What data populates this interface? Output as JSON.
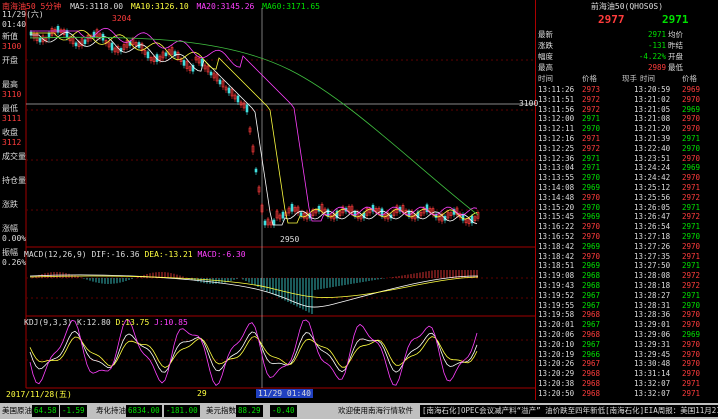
{
  "chart": {
    "title": "南海油50  5分钟",
    "ma": {
      "ma5": "MA5:3118.00",
      "ma10": "MA10:3126.10",
      "ma20": "MA20:3145.26",
      "ma60": "MA60:3171.65"
    },
    "high_mark": "3204",
    "low_mark": "2950",
    "price_level_label": "3100",
    "macd_header": {
      "name": "MACD(12,26,9)",
      "dif": "DIF:-16.36",
      "dea": "DEA:-13.21",
      "macd": "MACD:-6.30"
    },
    "kdj_header": {
      "name": "KDJ(9,3,3)",
      "k": "K:12.80",
      "d": "D:13.75",
      "j": "J:10.85"
    },
    "time_axis": {
      "left": "2017/11/28(五)",
      "mid": "29",
      "cursor": "11/29 01:40"
    },
    "info_box": {
      "date": "11/29(六)",
      "time": "01:40",
      "labels": [
        "新值",
        "开盘",
        "最高",
        "最低",
        "收盘",
        "成交量",
        "持仓量",
        "涨跌",
        "涨幅",
        "振幅"
      ],
      "values": [
        "3100",
        "",
        "3110",
        "3111",
        "3112",
        "",
        "",
        "",
        "0.00%",
        "0.26%"
      ]
    }
  },
  "panel": {
    "title": "前海油50(QHOS0S)",
    "bid_price": "2977",
    "ask_price": "2971",
    "stats": [
      {
        "label": "最新",
        "value": "2971",
        "label2": "均价",
        "color": "grn"
      },
      {
        "label": "涨跌",
        "value": "-131",
        "label2": "昨结",
        "color": "grn"
      },
      {
        "label": "幅度",
        "value": "-4.22%",
        "label2": "开盘",
        "color": "grn"
      },
      {
        "label": "最高",
        "value": "2989",
        "label2": "最低",
        "color": "red"
      }
    ],
    "col_headers": [
      "时间",
      "价格",
      "现手",
      "时间",
      "价格"
    ],
    "ticks_left": [
      {
        "t": "13:11:26",
        "p": "2973",
        "c": "red"
      },
      {
        "t": "13:11:51",
        "p": "2972",
        "c": "red"
      },
      {
        "t": "13:11:56",
        "p": "2972",
        "c": "red"
      },
      {
        "t": "13:12:00",
        "p": "2971",
        "c": "grn"
      },
      {
        "t": "13:12:11",
        "p": "2970",
        "c": "grn"
      },
      {
        "t": "13:12:16",
        "p": "2971",
        "c": "red"
      },
      {
        "t": "13:12:25",
        "p": "2972",
        "c": "red"
      },
      {
        "t": "13:12:36",
        "p": "2971",
        "c": "grn"
      },
      {
        "t": "13:13:04",
        "p": "2971",
        "c": "grn"
      },
      {
        "t": "13:13:55",
        "p": "2970",
        "c": "grn"
      },
      {
        "t": "13:14:08",
        "p": "2969",
        "c": "grn"
      },
      {
        "t": "13:14:48",
        "p": "2970",
        "c": "red"
      },
      {
        "t": "13:15:20",
        "p": "2970",
        "c": "grn"
      },
      {
        "t": "13:15:45",
        "p": "2969",
        "c": "grn"
      },
      {
        "t": "13:16:22",
        "p": "2970",
        "c": "red"
      },
      {
        "t": "13:16:52",
        "p": "2970",
        "c": "red"
      },
      {
        "t": "13:18:42",
        "p": "2969",
        "c": "grn"
      },
      {
        "t": "13:18:42",
        "p": "2970",
        "c": "red"
      },
      {
        "t": "13:18:51",
        "p": "2969",
        "c": "grn"
      },
      {
        "t": "13:19:08",
        "p": "2968",
        "c": "grn"
      },
      {
        "t": "13:19:43",
        "p": "2968",
        "c": "grn"
      },
      {
        "t": "13:19:52",
        "p": "2967",
        "c": "grn"
      },
      {
        "t": "13:19:55",
        "p": "2967",
        "c": "grn"
      },
      {
        "t": "13:19:58",
        "p": "2968",
        "c": "red"
      },
      {
        "t": "13:20:01",
        "p": "2967",
        "c": "grn"
      },
      {
        "t": "13:20:06",
        "p": "2968",
        "c": "red"
      },
      {
        "t": "13:20:10",
        "p": "2967",
        "c": "grn"
      },
      {
        "t": "13:20:19",
        "p": "2966",
        "c": "grn"
      },
      {
        "t": "13:20:26",
        "p": "2967",
        "c": "red"
      },
      {
        "t": "13:20:29",
        "p": "2968",
        "c": "red"
      },
      {
        "t": "13:20:38",
        "p": "2968",
        "c": "red"
      },
      {
        "t": "13:20:50",
        "p": "2968",
        "c": "red"
      }
    ],
    "ticks_right": [
      {
        "t": "13:20:59",
        "p": "2969",
        "c": "red"
      },
      {
        "t": "13:21:02",
        "p": "2970",
        "c": "red"
      },
      {
        "t": "13:21:05",
        "p": "2969",
        "c": "grn"
      },
      {
        "t": "13:21:08",
        "p": "2970",
        "c": "red"
      },
      {
        "t": "13:21:20",
        "p": "2970",
        "c": "red"
      },
      {
        "t": "13:21:39",
        "p": "2971",
        "c": "grn"
      },
      {
        "t": "13:22:40",
        "p": "2970",
        "c": "grn"
      },
      {
        "t": "13:23:51",
        "p": "2970",
        "c": "red"
      },
      {
        "t": "13:24:24",
        "p": "2969",
        "c": "grn"
      },
      {
        "t": "13:24:42",
        "p": "2970",
        "c": "red"
      },
      {
        "t": "13:25:12",
        "p": "2971",
        "c": "red"
      },
      {
        "t": "13:25:56",
        "p": "2972",
        "c": "red"
      },
      {
        "t": "13:26:05",
        "p": "2971",
        "c": "grn"
      },
      {
        "t": "13:26:47",
        "p": "2972",
        "c": "red"
      },
      {
        "t": "13:26:54",
        "p": "2971",
        "c": "grn"
      },
      {
        "t": "13:27:18",
        "p": "2970",
        "c": "grn"
      },
      {
        "t": "13:27:26",
        "p": "2970",
        "c": "red"
      },
      {
        "t": "13:27:35",
        "p": "2971",
        "c": "red"
      },
      {
        "t": "13:27:50",
        "p": "2971",
        "c": "grn"
      },
      {
        "t": "13:28:08",
        "p": "2972",
        "c": "red"
      },
      {
        "t": "13:28:18",
        "p": "2972",
        "c": "red"
      },
      {
        "t": "13:28:27",
        "p": "2971",
        "c": "grn"
      },
      {
        "t": "13:28:31",
        "p": "2970",
        "c": "grn"
      },
      {
        "t": "13:28:36",
        "p": "2970",
        "c": "red"
      },
      {
        "t": "13:29:01",
        "p": "2970",
        "c": "red"
      },
      {
        "t": "13:29:06",
        "p": "2969",
        "c": "grn"
      },
      {
        "t": "13:29:31",
        "p": "2970",
        "c": "red"
      },
      {
        "t": "13:29:45",
        "p": "2970",
        "c": "red"
      },
      {
        "t": "13:30:48",
        "p": "2970",
        "c": "red"
      },
      {
        "t": "13:31:14",
        "p": "2970",
        "c": "red"
      },
      {
        "t": "13:32:07",
        "p": "2971",
        "c": "red"
      },
      {
        "t": "13:32:07",
        "p": "2971",
        "c": "red"
      }
    ]
  },
  "status": {
    "i1_name": "美国原油",
    "i1_val": "64.58",
    "i1_chg": "-1.59",
    "i2_name": "寿化持油",
    "i2_val": "6834.00",
    "i2_chg": "-181.00",
    "i3_name": "美元指数",
    "i3_val": "88.29",
    "i3_chg": "-0.40",
    "welcome": "欢迎使用南海行情软件",
    "news": "[南海石化]OPEC会议减产料“溢产”  油价跌至四年新低[南海石化]EIA周报：美国11月21日当周原"
  },
  "colors": {
    "up": "#ff3c3c",
    "down": "#00e000",
    "bg": "#000000",
    "grid": "#a00000"
  }
}
